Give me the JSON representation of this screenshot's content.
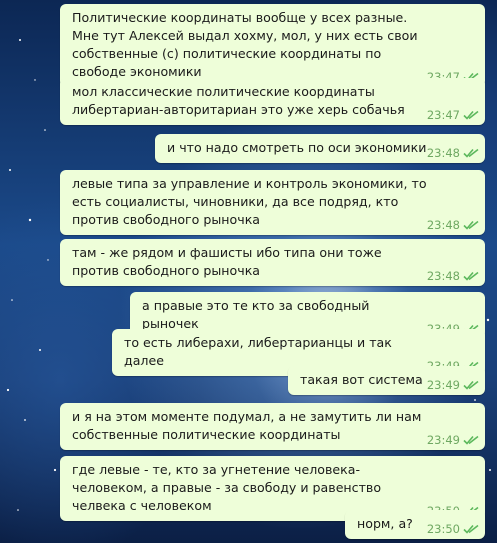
{
  "messages": [
    {
      "text": "Политические координаты вообще у всех разные. Мне тут Алексей выдал хохму, мол, у них есть свои собственные (с) политические координаты по свободе экономики",
      "time": "23:47"
    },
    {
      "text": "мол классические политические координаты либертариан-авторитариан это уже херь собачья",
      "time": "23:47"
    },
    {
      "text": "и что надо смотреть по оси экономики",
      "time": "23:48"
    },
    {
      "text": "левые типа за управление и контроль экономики, то есть социалисты, чиновники, да все подряд, кто против свободного рыночка",
      "time": "23:48"
    },
    {
      "text": "там - же рядом и фашисты ибо типа они тоже против свободного рыночка",
      "time": "23:48"
    },
    {
      "text": "а правые это те кто за свободный рыночек",
      "time": "23:49"
    },
    {
      "text": "то есть либерахи, либертарианцы и так далее",
      "time": "23:49"
    },
    {
      "text": "такая вот система",
      "time": "23:49"
    },
    {
      "text": "и я на этом моменте подумал, а не замутить ли нам собственные политические координаты",
      "time": "23:49"
    },
    {
      "text": "где левые - те, кто за угнетение человека-человеком, а правые - за свободу и равенство челвека с человеком",
      "time": "23:50"
    },
    {
      "text": "норм, а?",
      "time": "23:50"
    }
  ],
  "colors": {
    "bubble": "#eefed9",
    "time": "#6fa862",
    "ticks": "#5cb85c"
  },
  "icons": {
    "read_status": "double-check-icon"
  }
}
